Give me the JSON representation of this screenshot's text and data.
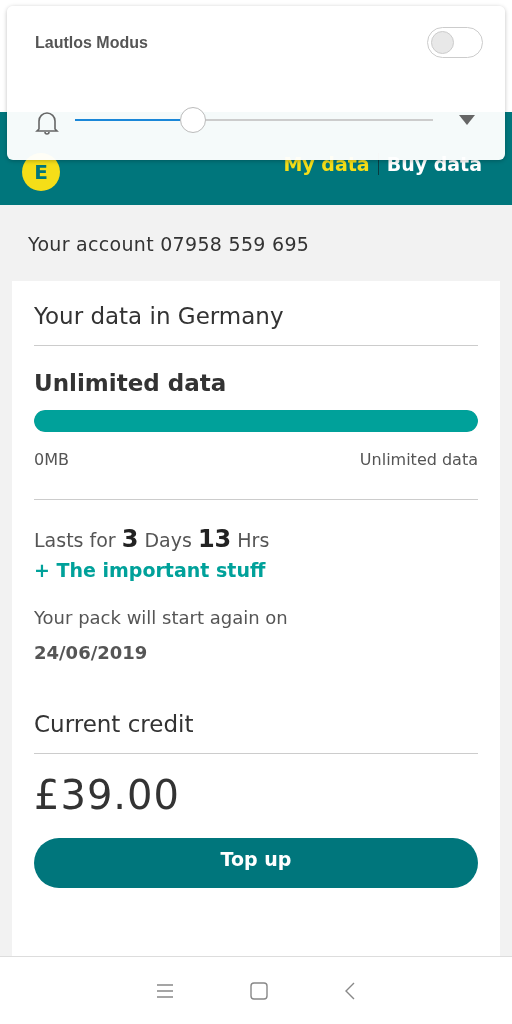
{
  "header": {
    "logo": "E",
    "nav": [
      {
        "label": "My data",
        "selected": true
      },
      {
        "label": "Buy data",
        "selected": false
      }
    ]
  },
  "account": "Your account 07958 559 695",
  "data_card": {
    "title": "Your data in Germany",
    "plan": "Unlimited data",
    "level": 1,
    "min_label": "0MB",
    "max_label": "Unlimited data",
    "lasts": "Lasts for **3** Days **13** Hrs",
    "important": "+ The important stuff",
    "restart": "Your pack will start again on",
    "date": "24/06/2019"
  },
  "credit": {
    "title": "Current credit",
    "amount": "£39.00",
    "button": "Top up"
  },
  "volume_panel": {
    "title": "Lautlos Modus",
    "on": false,
    "level": 0.33
  }
}
